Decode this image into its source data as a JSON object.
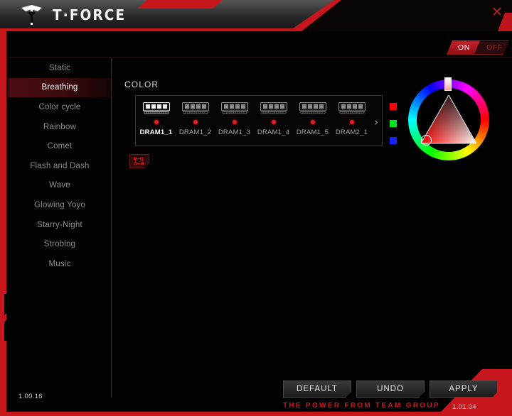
{
  "window": {
    "brand": "T·FORCE",
    "logo_icon": "tforce-logo-icon",
    "close_icon": "close-icon"
  },
  "power_toggle": {
    "on_label": "ON",
    "off_label": "OFF",
    "state": "ON"
  },
  "sidebar": {
    "items": [
      {
        "label": "Static",
        "active": false
      },
      {
        "label": "Breathing",
        "active": true
      },
      {
        "label": "Color cycle",
        "active": false
      },
      {
        "label": "Rainbow",
        "active": false
      },
      {
        "label": "Comet",
        "active": false
      },
      {
        "label": "Flash and Dash",
        "active": false
      },
      {
        "label": "Wave",
        "active": false
      },
      {
        "label": "Glowing Yoyo",
        "active": false
      },
      {
        "label": "Starry-Night",
        "active": false
      },
      {
        "label": "Strobing",
        "active": false
      },
      {
        "label": "Music",
        "active": false
      }
    ]
  },
  "main": {
    "section_label": "COLOR",
    "next_icon": "chevron-right-icon",
    "sync_icon": "link-sync-icon",
    "dram_modules": [
      {
        "name": "DRAM1_1",
        "selected": true,
        "led_color": "#e41c20"
      },
      {
        "name": "DRAM1_2",
        "selected": false,
        "led_color": "#e41c20"
      },
      {
        "name": "DRAM1_3",
        "selected": false,
        "led_color": "#e41c20"
      },
      {
        "name": "DRAM1_4",
        "selected": false,
        "led_color": "#e41c20"
      },
      {
        "name": "DRAM1_5",
        "selected": false,
        "led_color": "#e41c20"
      },
      {
        "name": "DRAM2_1",
        "selected": false,
        "led_color": "#e41c20"
      }
    ]
  },
  "color_picker": {
    "swatches": [
      {
        "name": "red-channel-swatch",
        "color": "#ff0000"
      },
      {
        "name": "green-channel-swatch",
        "color": "#00e321"
      },
      {
        "name": "blue-channel-swatch",
        "color": "#1822ff"
      }
    ],
    "selected_hue": "#ff0000",
    "hue_marker_icon": "hue-slider-handle",
    "sv_cursor_icon": "saturation-value-cursor"
  },
  "footer": {
    "default_label": "DEFAULT",
    "undo_label": "UNDO",
    "apply_label": "APPLY",
    "tagline": "THE POWER FROM TEAM GROUP",
    "version_left": "1.00.16",
    "version_right": "1.01.04"
  }
}
